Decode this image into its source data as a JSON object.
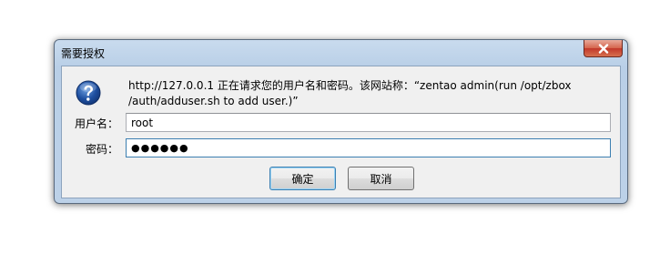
{
  "dialog": {
    "title": "需要授权",
    "message": "http://127.0.0.1 正在请求您的用户名和密码。该网站称：“zentao admin(run /opt/zbox /auth/adduser.sh to add user.)”",
    "username_label": "用户名：",
    "username_value": "root",
    "password_label": "密码：",
    "password_value": "●●●●●●",
    "ok_label": "确定",
    "cancel_label": "取消",
    "icons": {
      "help": "question-mark-icon",
      "close": "close-icon"
    },
    "colors": {
      "help_icon": "#1e4fa0",
      "close_button": "#c73b2b",
      "default_button_border": "#3c7fb1"
    }
  }
}
